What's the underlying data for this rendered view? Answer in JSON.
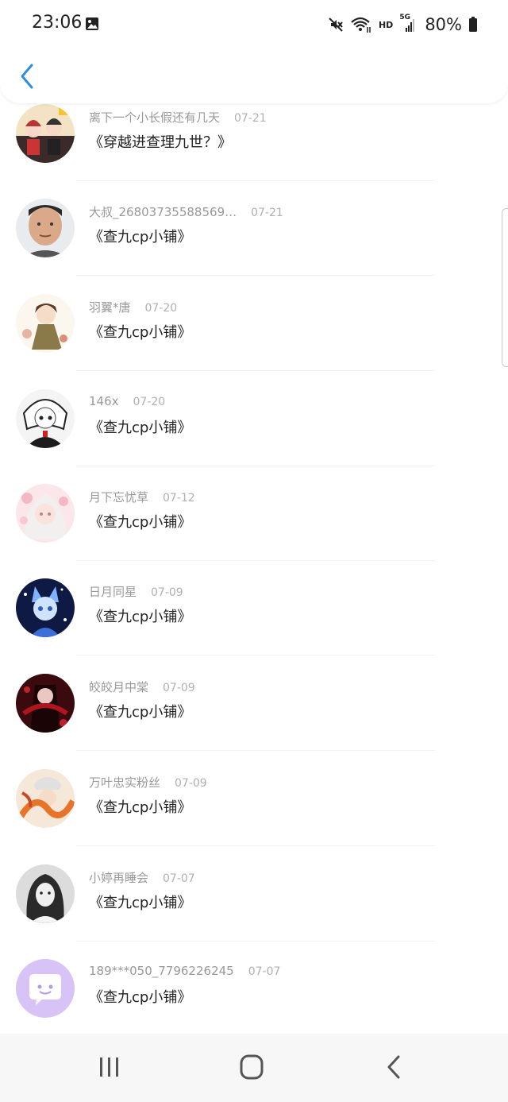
{
  "status_bar": {
    "time": "23:06",
    "network_label": "HD",
    "cell_label": "5G",
    "battery_text": "80%"
  },
  "header": {
    "back_icon": "chevron-left-icon",
    "accent_color": "#2a8fe0"
  },
  "items": [
    {
      "name": "离下一个小长假还有几天",
      "date": "07-21",
      "title": "《穿越进查理九世？》",
      "avatar": "anime-group"
    },
    {
      "name": "大叔_26803735588569…",
      "date": "07-21",
      "title": "《查九cp小铺》",
      "avatar": "man-photo"
    },
    {
      "name": "羽翼*唐",
      "date": "07-20",
      "title": "《查九cp小铺》",
      "avatar": "anime-brown"
    },
    {
      "name": "146x",
      "date": "07-20",
      "title": "《查九cp小铺》",
      "avatar": "anime-mono"
    },
    {
      "name": "月下忘忧草",
      "date": "07-12",
      "title": "《查九cp小铺》",
      "avatar": "anime-pink"
    },
    {
      "name": "日月同星",
      "date": "07-09",
      "title": "《查九cp小铺》",
      "avatar": "anime-blue"
    },
    {
      "name": "皎皎月中棠",
      "date": "07-09",
      "title": "《查九cp小铺》",
      "avatar": "anime-red"
    },
    {
      "name": "万叶忠实粉丝",
      "date": "07-09",
      "title": "《查九cp小铺》",
      "avatar": "anime-orange"
    },
    {
      "name": "小婷再睡会",
      "date": "07-07",
      "title": "《查九cp小铺》",
      "avatar": "anime-grey"
    },
    {
      "name": "189***050_7796226245",
      "date": "07-07",
      "title": "《查九cp小铺》",
      "avatar": "default-chat-icon"
    }
  ],
  "nav_bar": {
    "recents_icon": "recents-icon",
    "home_icon": "home-icon",
    "back_icon": "back-icon"
  }
}
